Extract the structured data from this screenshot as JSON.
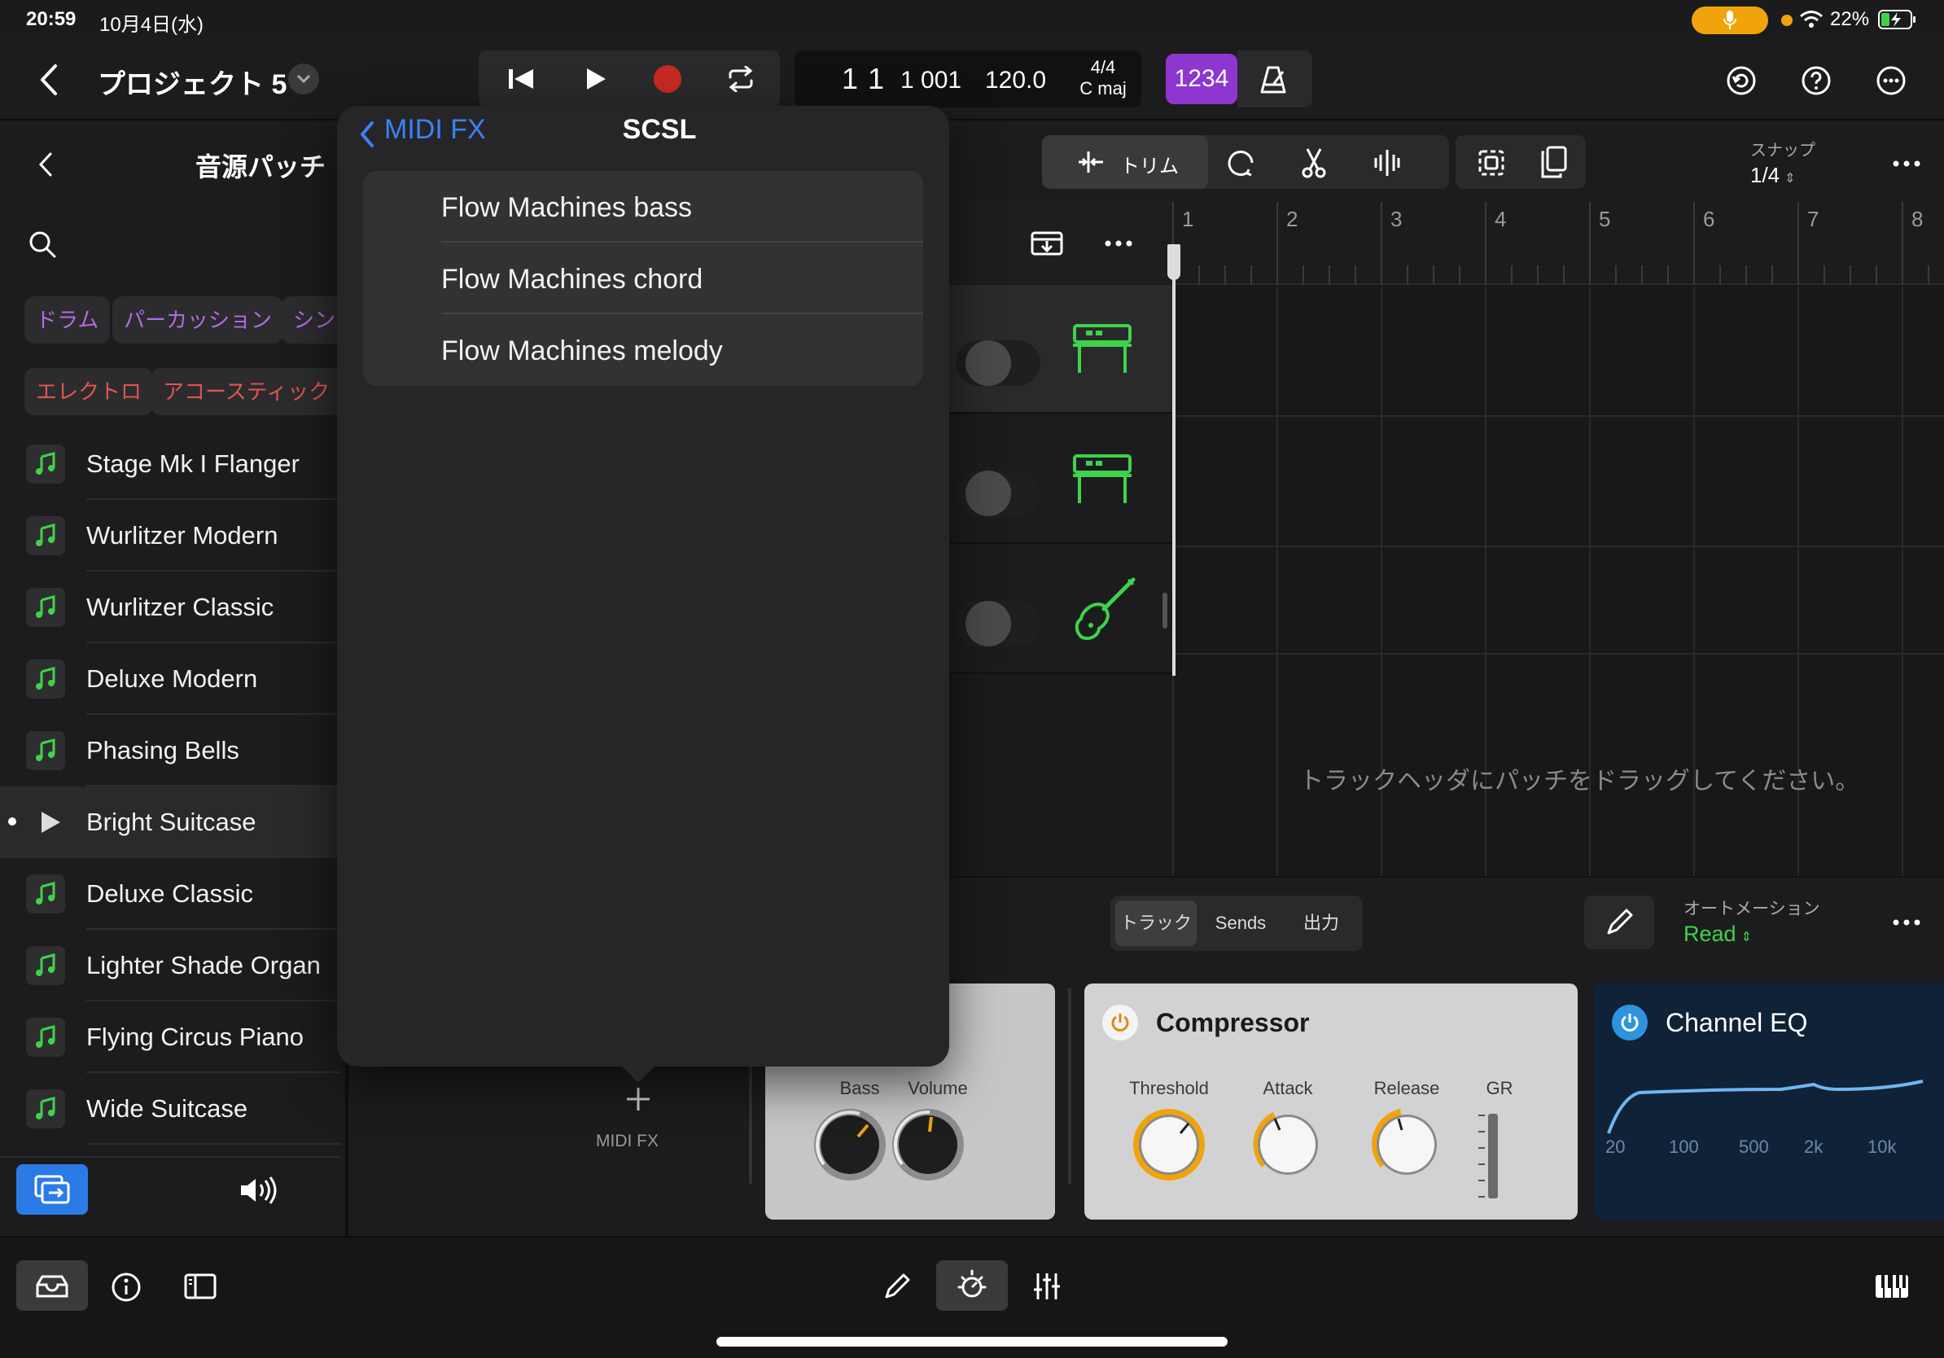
{
  "status_bar": {
    "time": "20:59",
    "date": "10月4日(水)",
    "battery": "22%"
  },
  "toolbar": {
    "project_title": "プロジェクト 5",
    "lcd": {
      "position": "1 1",
      "ticks": "1 001",
      "tempo": "120.0",
      "time_signature": "4/4",
      "key": "C maj"
    },
    "count_in": "1234"
  },
  "library": {
    "title": "音源パッチ",
    "filters_row1": [
      "ドラム",
      "パーカッション",
      "シン"
    ],
    "filters_row2": [
      "エレクトロ",
      "アコースティック"
    ],
    "patches": [
      {
        "name": "Stage Mk I Flanger",
        "playing": false
      },
      {
        "name": "Wurlitzer Modern",
        "playing": false
      },
      {
        "name": "Wurlitzer Classic",
        "playing": false
      },
      {
        "name": "Deluxe Modern",
        "playing": false
      },
      {
        "name": "Phasing Bells",
        "playing": false
      },
      {
        "name": "Bright Suitcase",
        "playing": true
      },
      {
        "name": "Deluxe Classic",
        "playing": false
      },
      {
        "name": "Lighter Shade Organ",
        "playing": false
      },
      {
        "name": "Flying Circus Piano",
        "playing": false
      },
      {
        "name": "Wide Suitcase",
        "playing": false
      }
    ]
  },
  "edit_bar": {
    "trim_label": "トリム",
    "snap_label": "スナップ",
    "snap_value": "1/4"
  },
  "timeline": {
    "bars": [
      "1",
      "2",
      "3",
      "4",
      "5",
      "6",
      "7",
      "8"
    ],
    "hint": "トラックヘッダにパッチをドラッグしてください。"
  },
  "bottom_panel": {
    "tabs": [
      "トラック",
      "Sends",
      "出力"
    ],
    "automation_label": "オートメーション",
    "automation_value": "Read",
    "midi_fx_label": "MIDI FX",
    "plugin1": {
      "knobs": [
        "Bass",
        "Volume"
      ]
    },
    "compressor": {
      "title": "Compressor",
      "knobs": [
        "Threshold",
        "Attack",
        "Release"
      ],
      "meter": "GR"
    },
    "channel_eq": {
      "title": "Channel EQ",
      "freqs": [
        "20",
        "100",
        "500",
        "2k",
        "10k"
      ]
    }
  },
  "popover": {
    "back_label": "MIDI FX",
    "title": "SCSL",
    "items": [
      "Flow Machines bass",
      "Flow Machines chord",
      "Flow Machines melody"
    ]
  },
  "colors": {
    "accent_blue": "#3a82f7",
    "record_red": "#c62a22",
    "count_in_purple": "#8e36d0",
    "track_icon_green": "#3ed34a",
    "mic_orange": "#f0a30a",
    "filter_purple": "#b36ae3",
    "filter_red": "#e0554d"
  }
}
